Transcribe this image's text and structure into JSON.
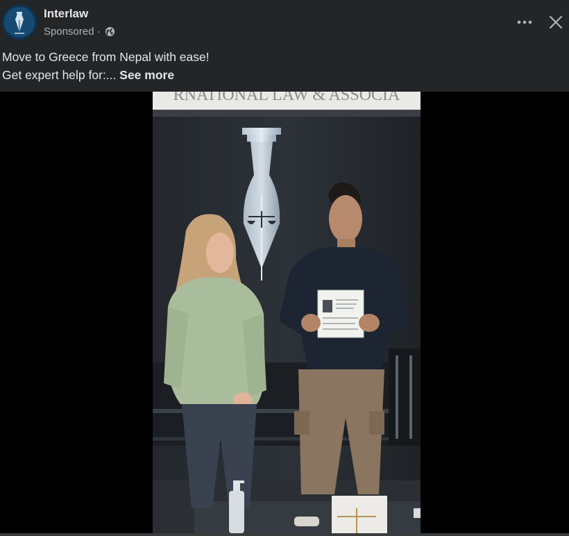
{
  "post": {
    "page_name": "Interlaw",
    "sponsored_label": "Sponsored",
    "separator": "·",
    "privacy_icon": "globe-icon",
    "text_line1": "Move to Greece from Nepal with ease!",
    "text_line2": "Get expert help for:...",
    "see_more": "See more"
  },
  "media": {
    "sign_text": "RNATIONAL    LAW & ASSOCIA",
    "type": "video"
  },
  "icons": {
    "more": "more-horizontal-icon",
    "close": "close-icon"
  },
  "colors": {
    "card_bg": "#242526",
    "text_primary": "#e4e6eb",
    "text_secondary": "#b0b3b8",
    "media_bg": "#000000"
  }
}
